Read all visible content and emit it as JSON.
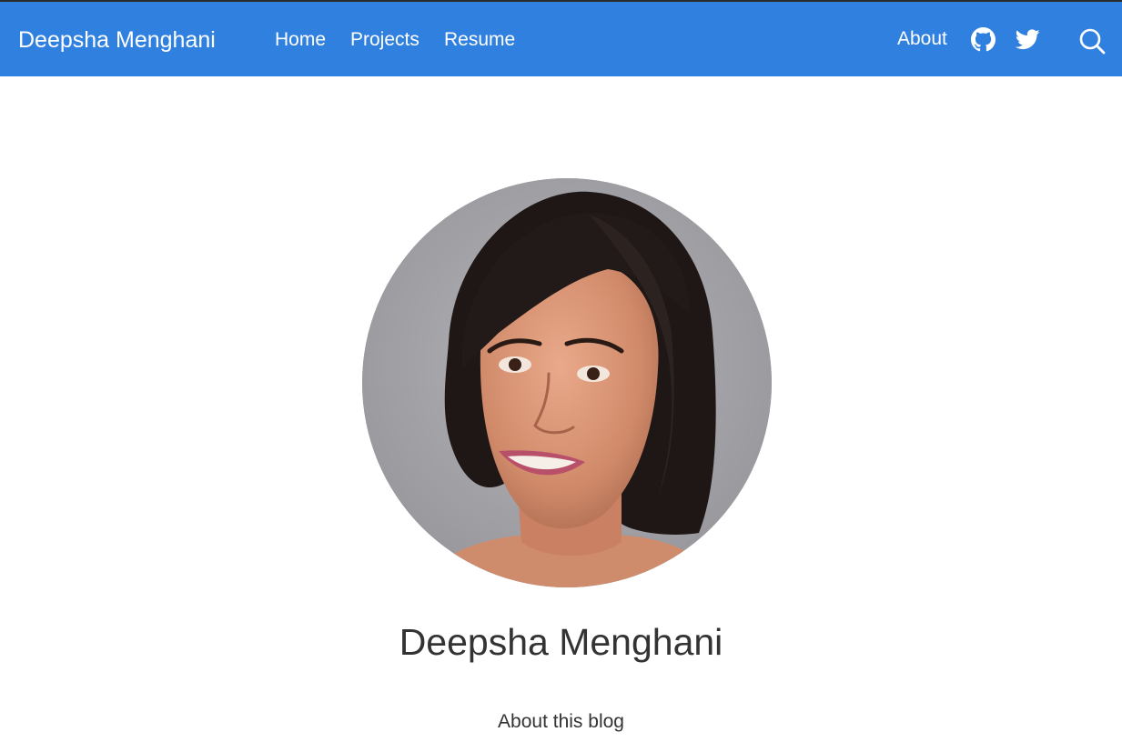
{
  "navbar": {
    "brand": "Deepsha Menghani",
    "links": [
      {
        "label": "Home"
      },
      {
        "label": "Projects"
      },
      {
        "label": "Resume"
      }
    ],
    "right": {
      "about_label": "About",
      "icons": [
        "github-icon",
        "twitter-icon",
        "search-icon"
      ]
    }
  },
  "profile": {
    "name": "Deepsha Menghani",
    "about_label": "About this blog"
  },
  "colors": {
    "navbar_bg": "#3080e0",
    "nav_text": "#ffffff",
    "body_text": "#333333",
    "page_bg": "#ffffff"
  }
}
